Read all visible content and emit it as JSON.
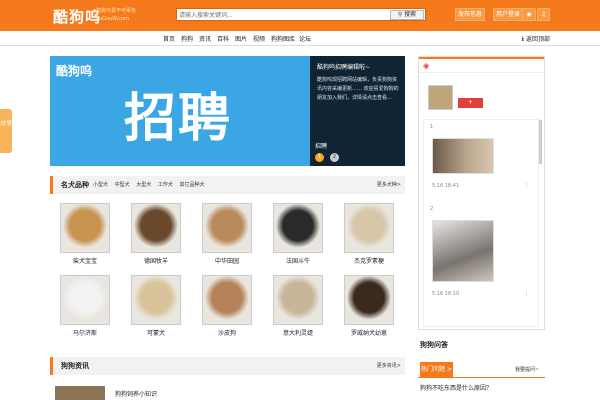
{
  "header": {
    "logo": "酷狗呜",
    "logo_tagline": "狗狗与爱不可辜负",
    "logo_domain": "KuGouW.com",
    "search_placeholder": "请输入搜索关键词...",
    "search_button": "搜索",
    "btn_publish": "发布信息",
    "btn_login": "用户登录"
  },
  "nav": {
    "items": [
      "首页",
      "狗狗",
      "资讯",
      "百科",
      "图片",
      "视频",
      "狗狗图库",
      "论坛"
    ],
    "right": "返回顶部"
  },
  "side_share": "分享",
  "banner": {
    "logo": "酷狗呜",
    "big_text": "招聘",
    "side_title": "酷狗呜招聘编辑啦~",
    "side_text": "酷狗呜现招聘网站编辑，负责狗狗资讯内容采编更新…… 欢迎喜爱狗狗的朋友加入我们，详情请点击查看…",
    "side_label": "招聘",
    "dots": [
      "1",
      "2"
    ]
  },
  "section_dogs": {
    "title": "名犬品种",
    "tags": [
      "小型犬",
      "中型犬",
      "大型犬",
      "工作犬",
      "其它品种犬"
    ],
    "more": "更多犬种>",
    "dogs": [
      {
        "name": "柴犬宝宝",
        "color": "#c8924f"
      },
      {
        "name": "德国牧羊",
        "color": "#6a4a2c"
      },
      {
        "name": "中华田园",
        "color": "#b98b5c"
      },
      {
        "name": "法国斗牛",
        "color": "#2a2a2a"
      },
      {
        "name": "杰克罗素梗",
        "color": "#d8c6a8"
      },
      {
        "name": "马尔济斯",
        "color": "#f2f2f2"
      },
      {
        "name": "可蒙犬",
        "color": "#d9c39a"
      },
      {
        "name": "沙皮狗",
        "color": "#b6825a"
      },
      {
        "name": "意大利灵缇",
        "color": "#c9b59a"
      },
      {
        "name": "罗威纳犬幼崽",
        "color": "#3a2a1c"
      }
    ]
  },
  "section_news": {
    "title": "狗狗资讯",
    "more": "更多资讯>",
    "item_title": "狗狗饲养小知识"
  },
  "right_panel": {
    "feed": [
      {
        "index": "1",
        "time": "5.16 18:41"
      },
      {
        "index": "2",
        "time": "5.16 18:10"
      }
    ],
    "follow": "+",
    "box_title": "狗狗问答",
    "tab": "热门问题 >",
    "tab_right": "我要提问~",
    "box_item": "狗狗不吃东西是什么原因？"
  },
  "colors": {
    "brand": "#f57a1c",
    "banner_blue": "#3aa6e4",
    "banner_dark": "#0f2535"
  }
}
